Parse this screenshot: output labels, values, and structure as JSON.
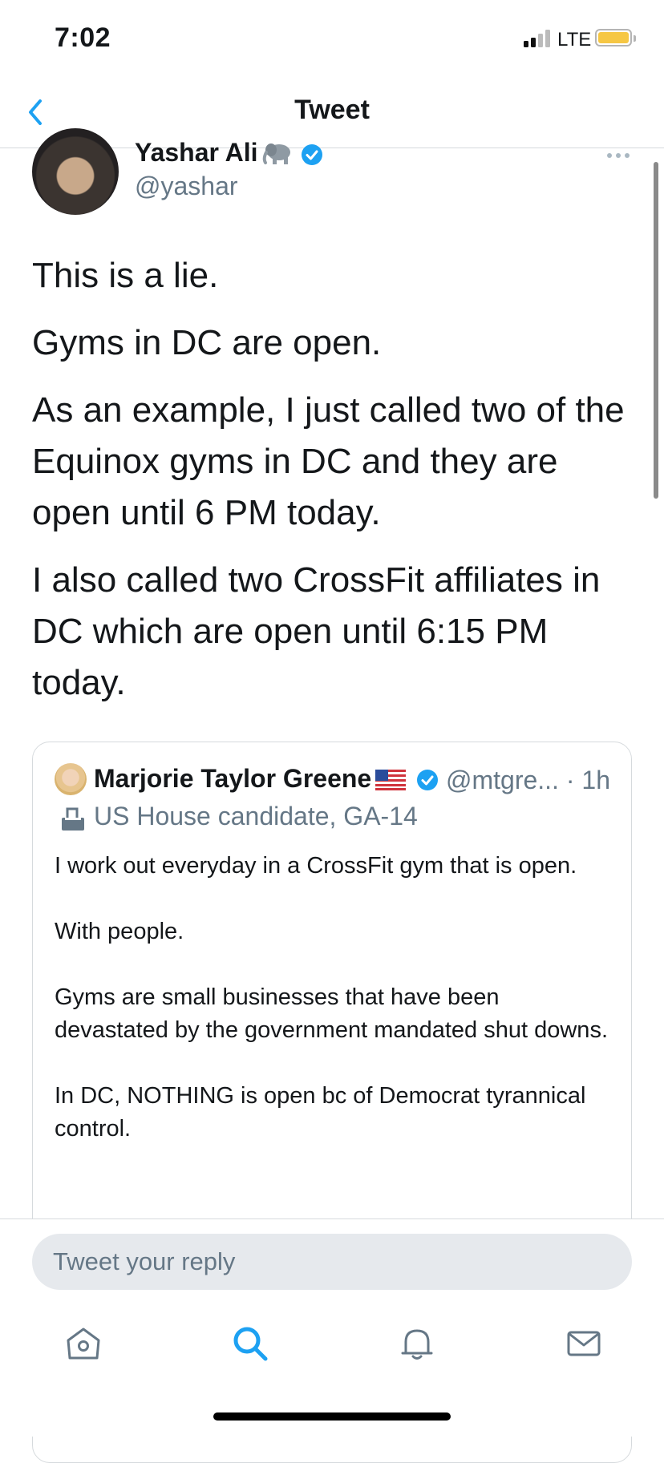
{
  "status_bar": {
    "time": "7:02",
    "network": "LTE",
    "signal_bars_active": 2,
    "battery_color": "#f6c744"
  },
  "nav": {
    "title": "Tweet",
    "back_icon": "chevron-left-icon",
    "accent_color": "#1da1f2"
  },
  "tweet": {
    "author_name": "Yashar Ali",
    "author_emoji": "elephant",
    "author_handle": "@yashar",
    "verified": true,
    "paragraphs": [
      "This is a lie.",
      "Gyms in DC are open.",
      "As an example, I just called two of the Equinox gyms in DC and they are open until 6 PM today.",
      "I also called two CrossFit affiliates in DC which are open until 6:15 PM today."
    ]
  },
  "quoted_tweet": {
    "author_name": "Marjorie Taylor Greene",
    "flag": "US flag",
    "verified": true,
    "handle_and_time": "@mtgre... · 1h",
    "label": "US House candidate, GA-14",
    "text": "I work out everyday in a CrossFit gym that is open.\n\nWith people.\n\nGyms are small businesses that have been devastated by the government mandated shut downs.\n\nIn DC, NOTHING is open bc of Democrat tyrannical control."
  },
  "reply": {
    "placeholder": "Tweet your reply"
  },
  "tab_bar": {
    "items": [
      {
        "icon": "home-icon",
        "active": false
      },
      {
        "icon": "search-icon",
        "active": true
      },
      {
        "icon": "notifications-bell-icon",
        "active": false
      },
      {
        "icon": "messages-envelope-icon",
        "active": false
      }
    ]
  }
}
